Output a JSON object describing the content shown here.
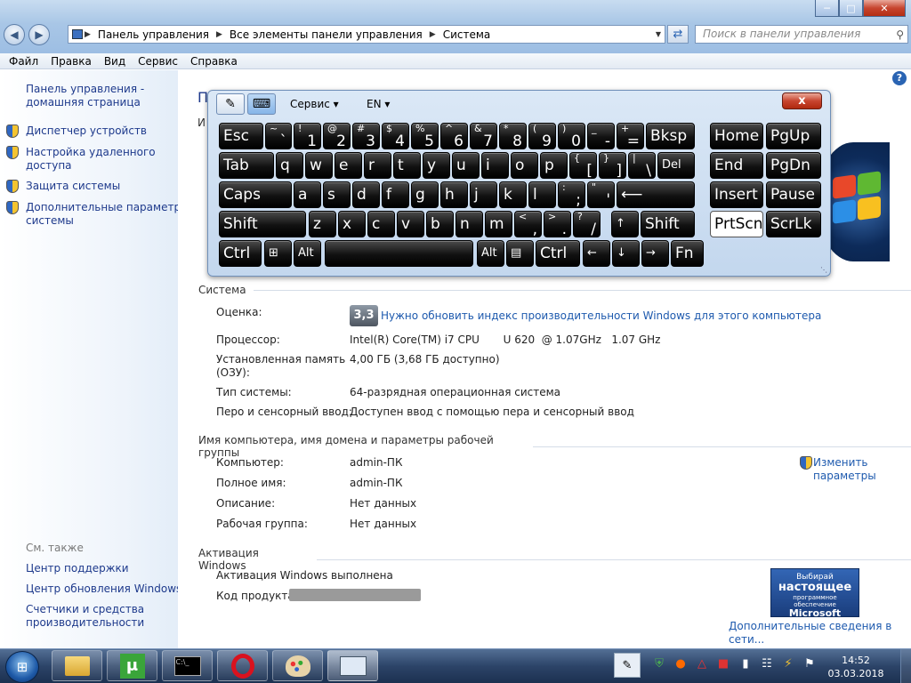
{
  "window": {
    "breadcrumb": [
      "Панель управления",
      "Все элементы панели управления",
      "Система"
    ],
    "search_placeholder": "Поиск в панели управления"
  },
  "menu": [
    "Файл",
    "Правка",
    "Вид",
    "Сервис",
    "Справка"
  ],
  "sidebar": {
    "home": [
      "Панель управления -",
      "домашняя страница"
    ],
    "items": [
      {
        "label": [
          "Диспетчер устройств"
        ]
      },
      {
        "label": [
          "Настройка удаленного",
          "доступа"
        ]
      },
      {
        "label": [
          "Защита системы"
        ]
      },
      {
        "label": [
          "Дополнительные параметры",
          "системы"
        ]
      }
    ],
    "see_also": "См. также",
    "links": [
      [
        "Центр поддержки"
      ],
      [
        "Центр обновления Windows"
      ],
      [
        "Счетчики и средства",
        "производительности"
      ]
    ]
  },
  "main": {
    "title_fragment": "П",
    "side_fragment": "И",
    "system_section": "Система",
    "rating_label": "Оценка:",
    "rating_value": "3,3",
    "rating_link": "Нужно обновить индекс производительности Windows для этого компьютера",
    "rows": [
      {
        "label": "Процессор:",
        "value": "Intel(R) Core(TM) i7 CPU       U 620  @ 1.07GHz   1.07 GHz"
      },
      {
        "label": "Установленная память\n(ОЗУ):",
        "value": "4,00 ГБ (3,68 ГБ доступно)"
      },
      {
        "label": "Тип системы:",
        "value": "64-разрядная операционная система"
      },
      {
        "label": "Перо и сенсорный ввод:",
        "value": "Доступен ввод с помощью пера и сенсорный ввод"
      }
    ],
    "computer_section": "Имя компьютера, имя домена и параметры рабочей группы",
    "computer_rows": [
      {
        "label": "Компьютер:",
        "value": "admin-ПК"
      },
      {
        "label": "Полное имя:",
        "value": "admin-ПК"
      },
      {
        "label": "Описание:",
        "value": "Нет данных"
      },
      {
        "label": "Рабочая группа:",
        "value": "Нет данных"
      }
    ],
    "change_settings": [
      "Изменить",
      "параметры"
    ],
    "activation_section": "Активация Windows",
    "activation_status": "Активация Windows выполнена",
    "product_key_label": "Код продукта:",
    "genuine_banner": {
      "line1": "Выбирай",
      "line2": "настоящее",
      "line3": "программное обеспечение",
      "line4": "Microsoft"
    },
    "more_info": "Дополнительные сведения в сети..."
  },
  "osk": {
    "service_menu": "Сервис",
    "lang": "EN",
    "close": "x",
    "keys": [
      {
        "id": "esc",
        "main": "Esc"
      },
      {
        "id": "grave",
        "shift": "~",
        "main": "`"
      },
      {
        "id": "1",
        "shift": "!",
        "main": "1"
      },
      {
        "id": "2",
        "shift": "@",
        "main": "2"
      },
      {
        "id": "3",
        "shift": "#",
        "main": "3"
      },
      {
        "id": "4",
        "shift": "$",
        "main": "4"
      },
      {
        "id": "5",
        "shift": "%",
        "main": "5"
      },
      {
        "id": "6",
        "shift": "^",
        "main": "6"
      },
      {
        "id": "7",
        "shift": "&",
        "main": "7"
      },
      {
        "id": "8",
        "shift": "*",
        "main": "8"
      },
      {
        "id": "9",
        "shift": "(",
        "main": "9"
      },
      {
        "id": "0",
        "shift": ")",
        "main": "0"
      },
      {
        "id": "minus",
        "shift": "_",
        "main": "-"
      },
      {
        "id": "equal",
        "shift": "+",
        "main": "="
      },
      {
        "id": "bksp",
        "main": "Bksp"
      },
      {
        "id": "home",
        "main": "Home"
      },
      {
        "id": "pgup",
        "main": "PgUp"
      },
      {
        "id": "tab",
        "main": "Tab"
      },
      {
        "id": "q",
        "main": "q"
      },
      {
        "id": "w",
        "main": "w"
      },
      {
        "id": "e",
        "main": "e"
      },
      {
        "id": "r",
        "main": "r"
      },
      {
        "id": "t",
        "main": "t"
      },
      {
        "id": "y",
        "main": "y"
      },
      {
        "id": "u",
        "main": "u"
      },
      {
        "id": "i",
        "main": "i"
      },
      {
        "id": "o",
        "main": "o"
      },
      {
        "id": "p",
        "main": "p"
      },
      {
        "id": "lbracket",
        "shift": "{",
        "main": "["
      },
      {
        "id": "rbracket",
        "shift": "}",
        "main": "]"
      },
      {
        "id": "backslash",
        "shift": "|",
        "main": "\\"
      },
      {
        "id": "del",
        "main": "Del"
      },
      {
        "id": "end",
        "main": "End"
      },
      {
        "id": "pgdn",
        "main": "PgDn"
      },
      {
        "id": "caps",
        "main": "Caps"
      },
      {
        "id": "a",
        "main": "a"
      },
      {
        "id": "s",
        "main": "s"
      },
      {
        "id": "d",
        "main": "d"
      },
      {
        "id": "f",
        "main": "f"
      },
      {
        "id": "g",
        "main": "g"
      },
      {
        "id": "h",
        "main": "h"
      },
      {
        "id": "j",
        "main": "j"
      },
      {
        "id": "k",
        "main": "k"
      },
      {
        "id": "l",
        "main": "l"
      },
      {
        "id": "semicolon",
        "shift": ":",
        "main": ";"
      },
      {
        "id": "quote",
        "shift": "\"",
        "main": "'"
      },
      {
        "id": "enter",
        "main": "⟵"
      },
      {
        "id": "insert",
        "main": "Insert"
      },
      {
        "id": "pause",
        "main": "Pause"
      },
      {
        "id": "lshift",
        "main": "Shift"
      },
      {
        "id": "z",
        "main": "z"
      },
      {
        "id": "x",
        "main": "x"
      },
      {
        "id": "c",
        "main": "c"
      },
      {
        "id": "v",
        "main": "v"
      },
      {
        "id": "b",
        "main": "b"
      },
      {
        "id": "n",
        "main": "n"
      },
      {
        "id": "m",
        "main": "m"
      },
      {
        "id": "comma",
        "shift": "<",
        "main": ","
      },
      {
        "id": "period",
        "shift": ">",
        "main": "."
      },
      {
        "id": "slash",
        "shift": "?",
        "main": "/"
      },
      {
        "id": "up",
        "main": "↑"
      },
      {
        "id": "rshift",
        "main": "Shift"
      },
      {
        "id": "prtscn",
        "main": "PrtScn"
      },
      {
        "id": "scrlk",
        "main": "ScrLk"
      },
      {
        "id": "lctrl",
        "main": "Ctrl"
      },
      {
        "id": "win",
        "main": "⊞"
      },
      {
        "id": "lalt",
        "main": "Alt"
      },
      {
        "id": "space",
        "main": ""
      },
      {
        "id": "ralt",
        "main": "Alt"
      },
      {
        "id": "menu",
        "main": "▤"
      },
      {
        "id": "rctrl",
        "main": "Ctrl"
      },
      {
        "id": "left",
        "main": "←"
      },
      {
        "id": "down",
        "main": "↓"
      },
      {
        "id": "right",
        "main": "→"
      },
      {
        "id": "fn",
        "main": "Fn"
      }
    ]
  },
  "taskbar": {
    "time": "14:52",
    "date": "03.03.2018"
  }
}
